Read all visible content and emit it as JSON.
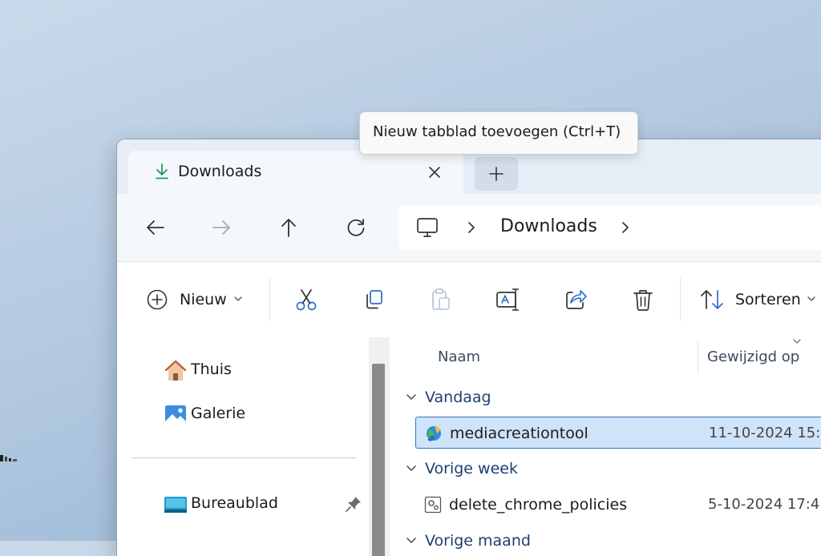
{
  "tooltip": {
    "text": "Nieuw tabblad toevoegen (Ctrl+T)"
  },
  "tab": {
    "title": "Downloads",
    "icon": "download-icon",
    "close_icon": "close-icon"
  },
  "new_tab": {
    "icon": "plus-icon"
  },
  "nav": {
    "back_icon": "arrow-left-icon",
    "forward_icon": "arrow-right-icon",
    "up_icon": "arrow-up-icon",
    "refresh_icon": "refresh-icon"
  },
  "address": {
    "root_icon": "this-pc-icon",
    "crumbs": [
      "Downloads"
    ]
  },
  "toolbar": {
    "new_label": "Nieuw",
    "sort_label": "Sorteren",
    "icons": [
      "plus-circle-icon",
      "cut-icon",
      "copy-icon",
      "paste-icon",
      "rename-icon",
      "share-icon",
      "delete-icon",
      "sort-icon"
    ]
  },
  "sidebar": {
    "items": [
      {
        "label": "Thuis",
        "icon": "home-icon"
      },
      {
        "label": "Galerie",
        "icon": "gallery-icon"
      },
      {
        "label": "Bureaublad",
        "icon": "desktop-icon",
        "pinned": true
      }
    ]
  },
  "columns": {
    "name": "Naam",
    "modified": "Gewijzigd op"
  },
  "groups": [
    {
      "label": "Vandaag",
      "files": [
        {
          "name": "mediacreationtool",
          "modified": "11-10-2024 15:",
          "selected": true
        }
      ]
    },
    {
      "label": "Vorige week",
      "files": [
        {
          "name": "delete_chrome_policies",
          "modified": "5-10-2024 17:4",
          "selected": false
        }
      ]
    },
    {
      "label": "Vorige maand",
      "files": []
    }
  ],
  "colors": {
    "accent": "#0067c0",
    "selection": "#cfe4fa",
    "download_green": "#1c9a5e"
  }
}
